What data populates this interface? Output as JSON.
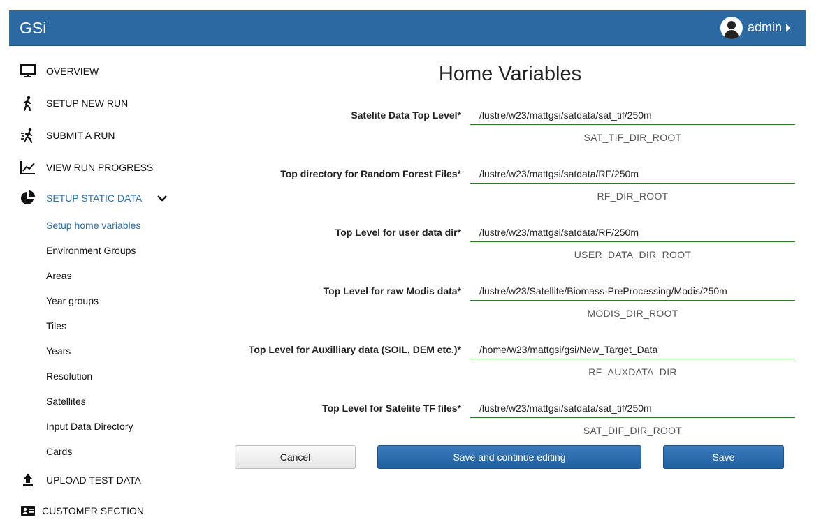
{
  "header": {
    "brand": "GSi",
    "user": "admin"
  },
  "sidebar": {
    "overview": "OVERVIEW",
    "setup_new_run": "SETUP NEW RUN",
    "submit_run": "SUBMIT A RUN",
    "view_progress": "VIEW RUN PROGRESS",
    "setup_static": "SETUP STATIC DATA",
    "sub_items": [
      "Setup home variables",
      "Environment Groups",
      "Areas",
      "Year groups",
      "Tiles",
      "Years",
      "Resolution",
      "Satellites",
      "Input Data Directory",
      "Cards"
    ],
    "upload_test": "UPLOAD TEST DATA",
    "customer": "CUSTOMER SECTION"
  },
  "main": {
    "title": "Home Variables",
    "fields": [
      {
        "label": "Satelite Data Top Level*",
        "value": "/lustre/w23/mattgsi/satdata/sat_tif/250m",
        "var": "SAT_TIF_DIR_ROOT"
      },
      {
        "label": "Top directory for Random Forest Files*",
        "value": "/lustre/w23/mattgsi/satdata/RF/250m",
        "var": "RF_DIR_ROOT"
      },
      {
        "label": "Top Level for user data dir*",
        "value": "/lustre/w23/mattgsi/satdata/RF/250m",
        "var": "USER_DATA_DIR_ROOT"
      },
      {
        "label": "Top Level for raw Modis data*",
        "value": "/lustre/w23/Satellite/Biomass-PreProcessing/Modis/250m",
        "var": "MODIS_DIR_ROOT"
      },
      {
        "label": "Top Level for Auxilliary data (SOIL, DEM etc.)*",
        "value": "/home/w23/mattgsi/gsi/New_Target_Data",
        "var": "RF_AUXDATA_DIR"
      },
      {
        "label": "Top Level for Satelite TF files*",
        "value": "/lustre/w23/mattgsi/satdata/sat_tif/250m",
        "var": "SAT_DIF_DIR_ROOT"
      }
    ],
    "buttons": {
      "cancel": "Cancel",
      "save_continue": "Save and continue editing",
      "save": "Save"
    }
  },
  "colors": {
    "header": "#2c69a3",
    "accent": "#2c6fb1",
    "input_underline": "#2f7a2f"
  }
}
